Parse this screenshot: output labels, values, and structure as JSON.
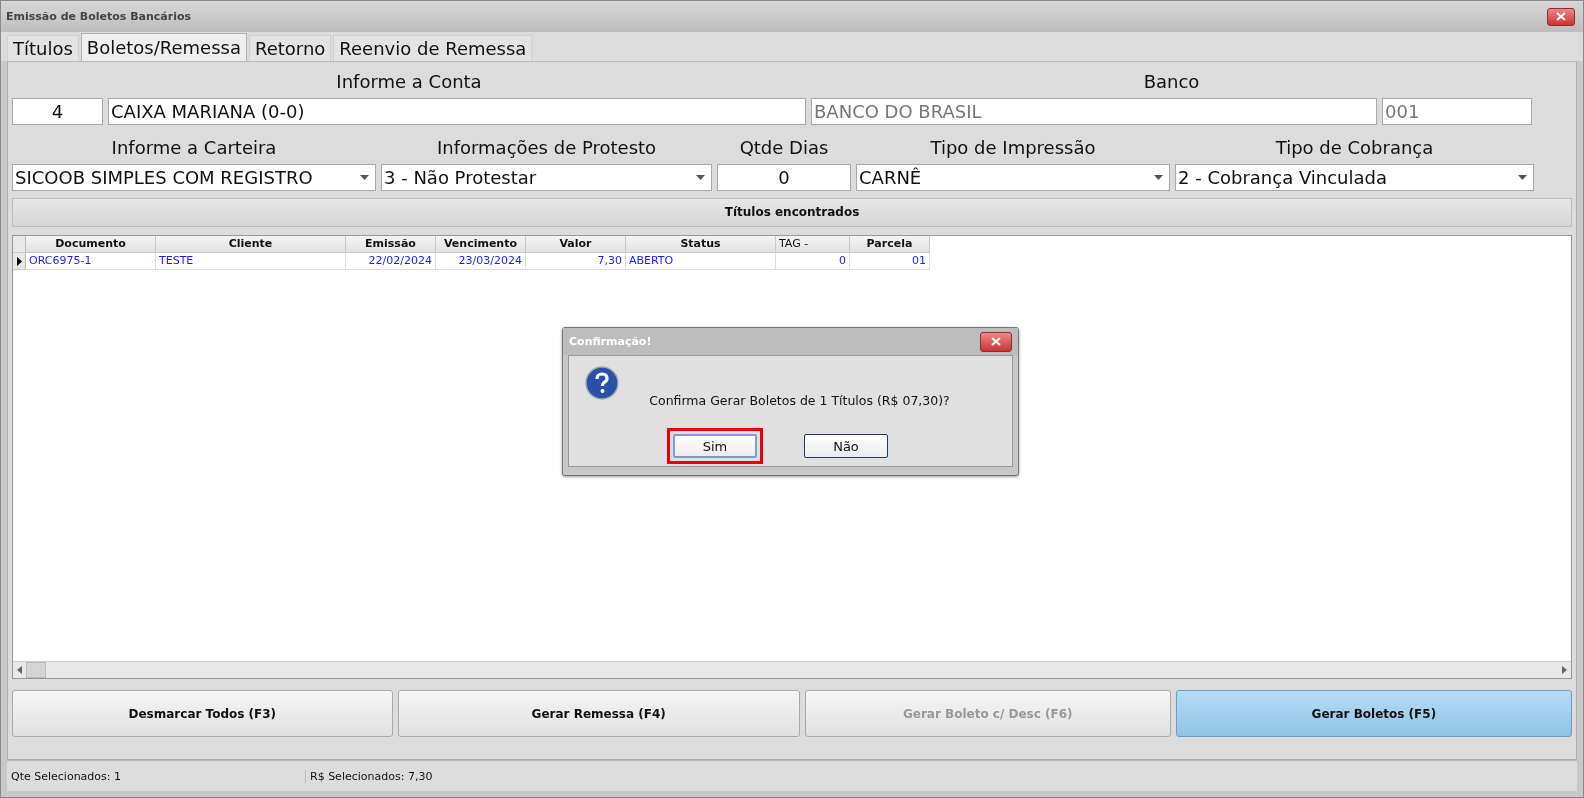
{
  "window": {
    "title": "Emissão de Boletos Bancários"
  },
  "tabs": [
    {
      "label": "Títulos",
      "selected": false
    },
    {
      "label": "Boletos/Remessa",
      "selected": true
    },
    {
      "label": "Retorno",
      "selected": false
    },
    {
      "label": "Reenvio de Remessa",
      "selected": false
    }
  ],
  "conta": {
    "label": "Informe a Conta",
    "code": "4",
    "name": "CAIXA MARIANA (0-0)"
  },
  "banco": {
    "label": "Banco",
    "name": "BANCO DO BRASIL",
    "code": "001",
    "readonly": true
  },
  "options": [
    {
      "label": "Informe a Carteira",
      "value": "SICOOB SIMPLES COM REGISTRO",
      "kind": "dropdown"
    },
    {
      "label": "Informações de Protesto",
      "value": "3 - Não Protestar",
      "kind": "dropdown"
    },
    {
      "label": "Qtde Dias",
      "value": "0",
      "kind": "number"
    },
    {
      "label": "Tipo de Impressão",
      "value": "CARNÊ",
      "kind": "dropdown"
    },
    {
      "label": "Tipo de Cobrança",
      "value": "2 - Cobrança Vinculada",
      "kind": "dropdown"
    }
  ],
  "table": {
    "title": "Títulos encontrados",
    "columns": [
      "Documento",
      "Cliente",
      "Emissão",
      "Vencimento",
      "Valor",
      "Status",
      "TAG -",
      "Parcela"
    ],
    "rows": [
      {
        "current": true,
        "cells": [
          "ORC6975-1",
          "TESTE",
          "22/02/2024",
          "23/03/2024",
          "7,30",
          "ABERTO",
          "0",
          "01"
        ]
      }
    ]
  },
  "buttons": [
    {
      "label": "Desmarcar Todos (F3)",
      "disabled": false,
      "focused": false
    },
    {
      "label": "Gerar Remessa (F4)",
      "disabled": false,
      "focused": false
    },
    {
      "label": "Gerar Boleto c/ Desc (F6)",
      "disabled": true,
      "focused": false
    },
    {
      "label": "Gerar Boletos (F5)",
      "disabled": false,
      "focused": true
    }
  ],
  "status_bar": [
    "Qte Selecionados: 1",
    "R$ Selecionados: 7,30"
  ],
  "dialog": {
    "title": "Confirmação!",
    "message": "Confirma Gerar Boletos de 1 Títulos (R$ 07,30)?",
    "buttons": [
      {
        "label": "Sim",
        "default": true,
        "marked": true
      },
      {
        "label": "Não",
        "default": false,
        "marked": false
      }
    ]
  }
}
